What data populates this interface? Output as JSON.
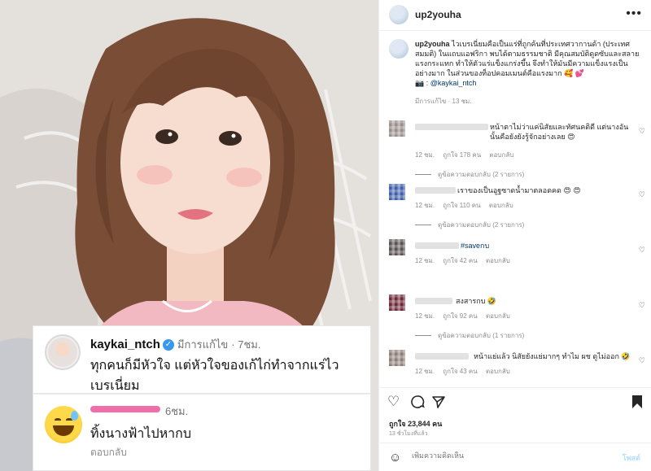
{
  "overlay": {
    "caption_card": {
      "username": "kaykai_ntch",
      "edited": "มีการแก้ไข",
      "time": "· 7ชม.",
      "text": "ทุกคนก็มีหัวใจ  แต่หัวใจของเก้ไก่ทำจากแร่ไวเบรเนี่ยม"
    },
    "reply_card": {
      "time": "6ชม.",
      "text": "ทิ้งนางฟ้าไปหากบ",
      "reply": "ตอบกลับ"
    }
  },
  "post": {
    "username": "up2youha",
    "more_icon": "more-horizontal-icon",
    "caption_username": "up2youha",
    "caption_text": "ไวเบรเนี่ยมคือเป็นแร่ที่ถูกค้นที่ประเทศวากานด้า (ประเทศสมมติ) ในแถบแอฟริกา พบได้ตามธรรมชาติ มีคุณสมบัติดูดซับและสลายแรงกระแทก ทำให้ตัวแร่แข็งแกร่งขึ้น จึงทำให้มันมีความแข็งแรงเป็นอย่างมาก ในส่วนของท็อปคอมเมนต์คือแรงมาก 🥰 💕",
    "caption_credit_prefix": "📷 : ",
    "caption_mention": "@kaykai_ntch",
    "caption_meta": "มีการแก้ไข · 13 ชม."
  },
  "comments": [
    {
      "text": "หน้าตาไม่ว่าแค่นิสัยและทัศนคติดี แต่นางอันนั้นคือยังยังรู้จักอย่างเลย 😍",
      "time": "12 ชม.",
      "likes": "ถูกใจ 178 คน",
      "reply": "ตอบกลับ",
      "view_replies": "ดูข้อความตอบกลับ (2 รายการ)",
      "colors": [
        "#9a8f8c",
        "#c9c2c0"
      ]
    },
    {
      "text": "เราของเป็นอูฐซาดน้ำมาตลอดคด 😍 😍",
      "time": "12 ชม.",
      "likes": "ถูกใจ 110 คน",
      "reply": "ตอบกลับ",
      "view_replies": "ดูข้อความตอบกลับ (2 รายการ)",
      "colors": [
        "#3f5fa8",
        "#8aa0d0"
      ]
    },
    {
      "text": "#saveกบ",
      "time": "12 ชม.",
      "likes": "ถูกใจ 42 คน",
      "reply": "ตอบกลับ",
      "view_replies": "",
      "colors": [
        "#5a5352",
        "#a9a2a0"
      ]
    },
    {
      "text": "สงสารกบ 🤣",
      "time": "12 ชม.",
      "likes": "ถูกใจ 92 คน",
      "reply": "ตอบกลับ",
      "view_replies": "ดูข้อความตอบกลับ (1 รายการ)",
      "colors": [
        "#6e2a38",
        "#a37d84"
      ]
    },
    {
      "text": "หน้าแย่แล้ว นิสัยยังแย่มากๆ ทำไม ผช ดูไม่ออก 🤣",
      "time": "12 ชม.",
      "likes": "ถูกใจ 43 คน",
      "reply": "ตอบกลับ",
      "view_replies": "",
      "colors": [
        "#8d7f79",
        "#cfc4be"
      ]
    }
  ],
  "actions": {
    "like_icon": "heart-icon",
    "comment_icon": "comment-icon",
    "share_icon": "send-icon",
    "save_icon": "bookmark-icon"
  },
  "likes_text": "ถูกใจ 23,844 คน",
  "posted_ago": "13 ชั่วโมงที่แล้ว",
  "add_comment": {
    "placeholder": "เพิ่มความคิดเห็น",
    "post_label": "โพสต์"
  }
}
